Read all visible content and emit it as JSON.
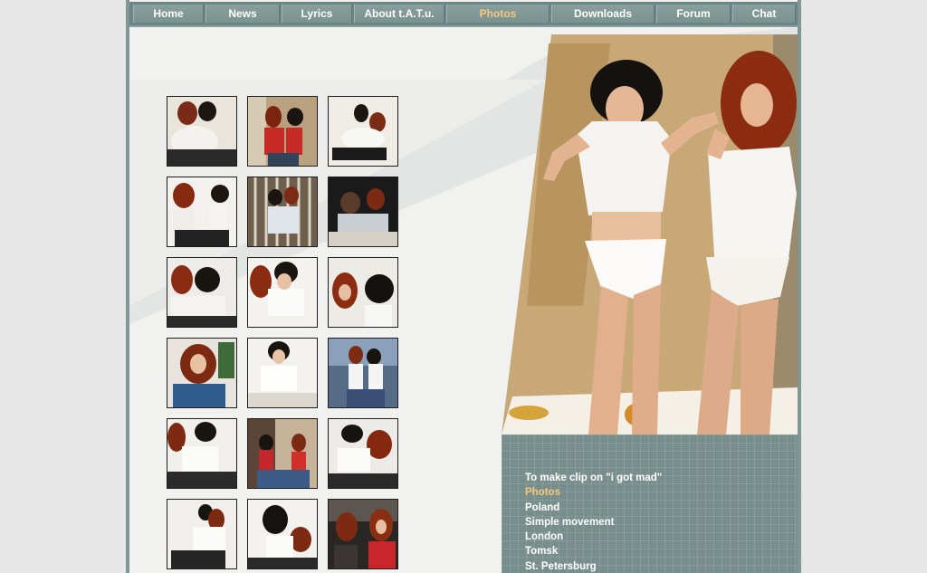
{
  "nav": {
    "items": [
      {
        "label": "Home",
        "active": false
      },
      {
        "label": "News",
        "active": false
      },
      {
        "label": "Lyrics",
        "active": false
      },
      {
        "label": "About t.A.T.u.",
        "active": false
      },
      {
        "label": "Photos",
        "active": true
      },
      {
        "label": "Downloads",
        "active": false
      },
      {
        "label": "Forum",
        "active": false
      },
      {
        "label": "Chat",
        "active": false
      }
    ]
  },
  "colors": {
    "frame": "#7f9795",
    "nav_bg": "#6b8785",
    "active_text": "#f6c77d",
    "panel": "#788e8c",
    "page_bg": "#e7e7e7"
  },
  "gallery": {
    "thumbnail_count": 18,
    "columns": 3
  },
  "album_menu": {
    "items": [
      {
        "label": "To make clip on \"i got mad\"",
        "active": false
      },
      {
        "label": "Photos",
        "active": true
      },
      {
        "label": "Poland",
        "active": false
      },
      {
        "label": "Simple movement",
        "active": false
      },
      {
        "label": "London",
        "active": false
      },
      {
        "label": "Tomsk",
        "active": false
      },
      {
        "label": "St. Petersburg",
        "active": false
      }
    ]
  }
}
